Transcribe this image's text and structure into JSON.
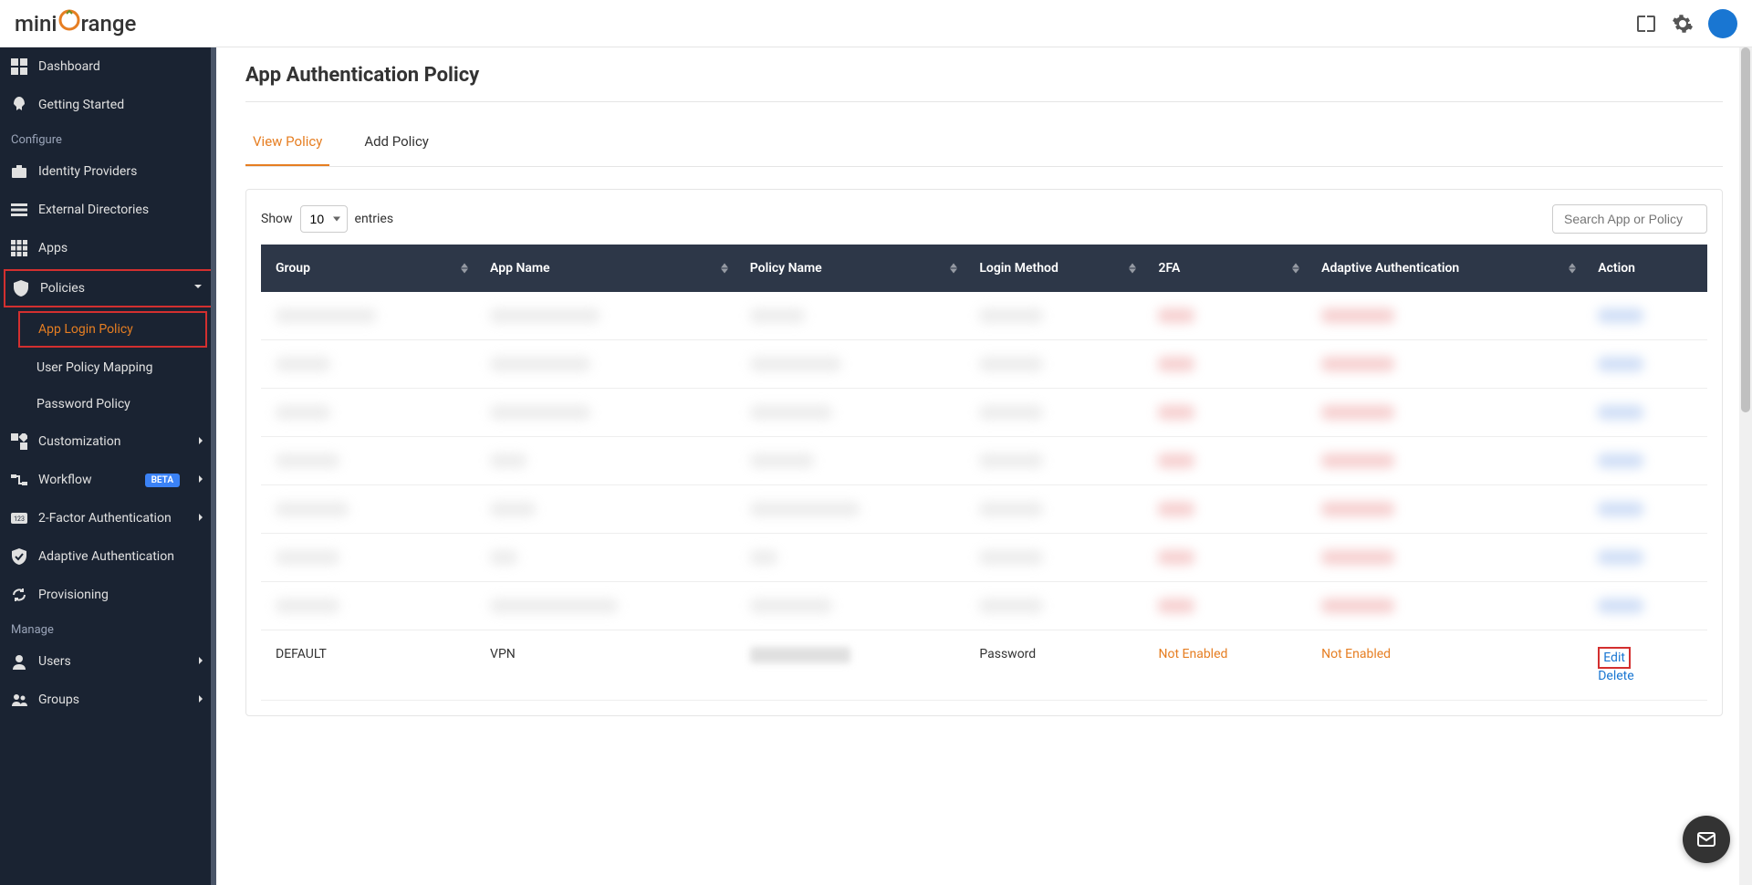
{
  "brand": {
    "mini": "mini",
    "range": "range"
  },
  "sidebar": {
    "items": [
      {
        "label": "Dashboard",
        "icon": "dashboard-icon"
      },
      {
        "label": "Getting Started",
        "icon": "rocket-icon"
      }
    ],
    "sections": {
      "configure": "Configure",
      "manage": "Manage"
    },
    "configure_items": [
      {
        "label": "Identity Providers",
        "icon": "briefcase-icon"
      },
      {
        "label": "External Directories",
        "icon": "list-icon"
      },
      {
        "label": "Apps",
        "icon": "apps-icon"
      },
      {
        "label": "Policies",
        "icon": "shield-icon",
        "expanded": true,
        "highlighted": true
      },
      {
        "label": "App Login Policy",
        "sub": true,
        "active": true,
        "highlighted": true
      },
      {
        "label": "User Policy Mapping",
        "sub": true
      },
      {
        "label": "Password Policy",
        "sub": true
      },
      {
        "label": "Customization",
        "icon": "widgets-icon",
        "chevron": true
      },
      {
        "label": "Workflow",
        "icon": "workflow-icon",
        "beta": true,
        "chevron": true
      },
      {
        "label": "2-Factor Authentication",
        "icon": "number-icon",
        "chevron": true
      },
      {
        "label": "Adaptive Authentication",
        "icon": "shield-check-icon"
      },
      {
        "label": "Provisioning",
        "icon": "sync-icon"
      }
    ],
    "manage_items": [
      {
        "label": "Users",
        "icon": "user-icon",
        "chevron": true
      },
      {
        "label": "Groups",
        "icon": "group-icon",
        "chevron": true
      }
    ],
    "beta_label": "BETA"
  },
  "page": {
    "title": "App Authentication Policy",
    "tabs": [
      {
        "label": "View Policy",
        "active": true
      },
      {
        "label": "Add Policy",
        "active": false
      }
    ],
    "show_label": "Show",
    "entries_value": "10",
    "entries_label": "entries",
    "search_placeholder": "Search App or Policy",
    "columns": [
      "Group",
      "App Name",
      "Policy Name",
      "Login Method",
      "2FA",
      "Adaptive Authentication",
      "Action"
    ],
    "visible_row": {
      "group": "DEFAULT",
      "app_name": "VPN",
      "policy_name": "",
      "login_method": "Password",
      "two_fa": "Not Enabled",
      "adaptive": "Not Enabled",
      "action_edit": "Edit",
      "action_delete": "Delete"
    }
  },
  "colors": {
    "brand_orange": "#e67e22",
    "sidebar_bg": "#1a2332",
    "table_header": "#2d3748",
    "highlight_red": "#d32f2f",
    "link_blue": "#1976d2"
  }
}
